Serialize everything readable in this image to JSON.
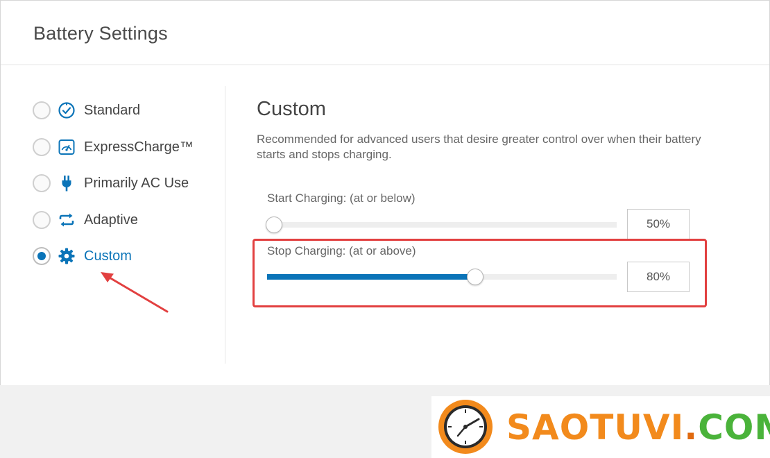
{
  "window": {
    "title": "Battery Settings"
  },
  "modes": [
    {
      "label": "Standard",
      "icon": "standard-clock-check-icon",
      "selected": false
    },
    {
      "label": "ExpressCharge™",
      "icon": "express-charge-gauge-icon",
      "selected": false
    },
    {
      "label": "Primarily AC Use",
      "icon": "ac-plug-icon",
      "selected": false
    },
    {
      "label": "Adaptive",
      "icon": "adaptive-arrows-icon",
      "selected": false
    },
    {
      "label": "Custom",
      "icon": "custom-gear-icon",
      "selected": true
    }
  ],
  "custom": {
    "title": "Custom",
    "description": "Recommended for advanced users that desire greater control over when their battery starts and stops charging.",
    "start": {
      "label": "Start Charging: (at or below)",
      "value_text": "50%",
      "level": 0.02
    },
    "stop": {
      "label": "Stop Charging: (at or above)",
      "value_text": "80%",
      "level": 0.595
    }
  },
  "colors": {
    "accent": "#0b74b8",
    "highlight": "#e24040",
    "watermark_orange": "#f28a1c",
    "watermark_green": "#4ab33a"
  },
  "watermark": {
    "text_main": "SAOTUVI",
    "text_dot": ".",
    "text_com": "COM",
    "logo_icon": "clock-logo-icon"
  }
}
